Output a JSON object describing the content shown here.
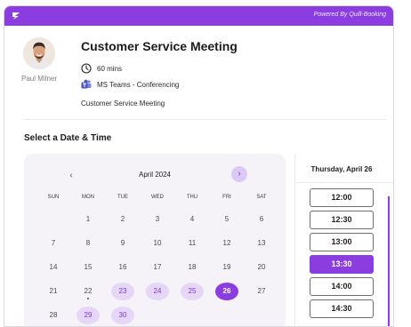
{
  "powered_by": "Powered By Quill-Booking",
  "host": {
    "name": "Paul Milner"
  },
  "event": {
    "title": "Customer Service Meeting",
    "duration": "60 mins",
    "location": "MS Teams - Conferencing",
    "description": "Customer Service Meeting"
  },
  "section_title": "Select a Date & Time",
  "calendar": {
    "month": "April 2024",
    "weekdays": [
      "SUN",
      "MON",
      "TUE",
      "WED",
      "THU",
      "FRI",
      "SAT"
    ],
    "weeks": [
      [
        null,
        "1",
        "2",
        "3",
        "4",
        "5",
        "6"
      ],
      [
        "7",
        "8",
        "9",
        "10",
        "11",
        "12",
        "13"
      ],
      [
        "14",
        "15",
        "16",
        "17",
        "18",
        "19",
        "20"
      ],
      [
        "21",
        "22",
        "23",
        "24",
        "25",
        "26",
        "27"
      ],
      [
        "28",
        "29",
        "30",
        null,
        null,
        null,
        null
      ]
    ],
    "available_days": [
      "23",
      "24",
      "25",
      "29",
      "30"
    ],
    "selected_day": "26",
    "today_day": "22"
  },
  "times": {
    "heading": "Thursday, April 26",
    "slots": [
      "12:00",
      "12:30",
      "13:00",
      "13:30",
      "14:00",
      "14:30"
    ],
    "selected": "13:30"
  },
  "colors": {
    "accent": "#8b3ddf",
    "available_bg": "#e6d7f8"
  }
}
